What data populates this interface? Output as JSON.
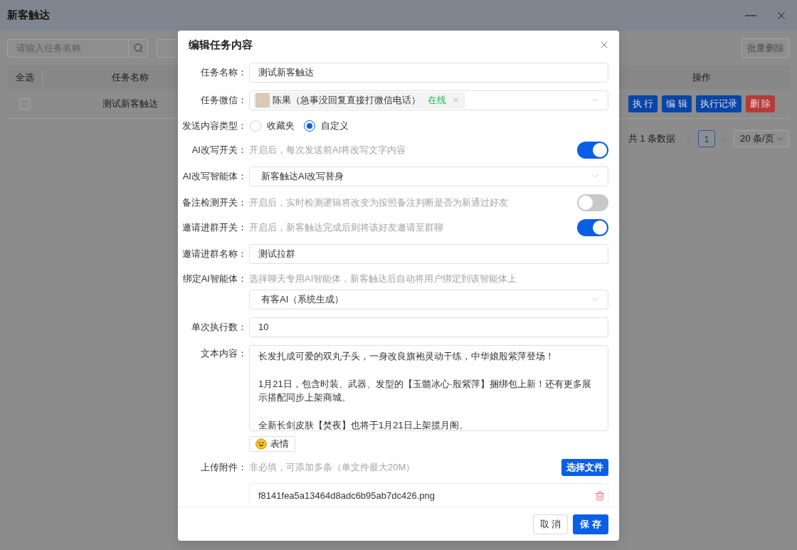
{
  "app": {
    "title": "新客触达"
  },
  "toolbar": {
    "search": {
      "placeholder": "请输入任务名称"
    },
    "batch_delete": {
      "label": "批量删除",
      "disabled": true
    }
  },
  "table": {
    "columns": [
      {
        "label": "全选",
        "kind": "select"
      },
      {
        "label": "任务名称",
        "kind": "name"
      },
      {
        "label": "操作",
        "kind": "actions"
      }
    ],
    "rows": [
      {
        "checked": false,
        "name": "测试新客触达",
        "actions": [
          {
            "label": "执 行",
            "kind": "primary"
          },
          {
            "label": "编 辑",
            "kind": "primary"
          },
          {
            "label": "执行记录",
            "kind": "primary"
          },
          {
            "label": "删 除",
            "kind": "danger"
          }
        ]
      }
    ]
  },
  "pagination": {
    "total": "共 1 条数据",
    "pages": [
      {
        "label": "1",
        "selected": true
      }
    ],
    "page_size": "20 条/页"
  },
  "dialog": {
    "title": "编辑任务内容",
    "fields": [
      {
        "kind": "input",
        "label": "任务名称：",
        "value": "测试新客触达"
      },
      {
        "kind": "tags",
        "label": "任务微信：",
        "tags": [
          {
            "name": "陈果（急事没回复直接打微信电话）",
            "status": "在线"
          }
        ]
      },
      {
        "kind": "radio",
        "label": "发送内容类型：",
        "options": [
          {
            "label": "收藏夹",
            "selected": false
          },
          {
            "label": "自定义",
            "selected": true
          }
        ]
      },
      {
        "kind": "switch",
        "label": "AI改写开关：",
        "hint": "开启后，每次发送前AI将改写文字内容",
        "on": true
      },
      {
        "kind": "select",
        "label": "AI改写智能体：",
        "value": "新客触达AI改写替身"
      },
      {
        "kind": "switch",
        "label": "备注检测开关：",
        "hint": "开启后，实时检测逻辑将改变为按照备注判断是否为新通过好友",
        "on": false
      },
      {
        "kind": "switch",
        "label": "邀请进群开关：",
        "hint": "开启后，新客触达完成后则将该好友邀请至群聊",
        "on": true
      },
      {
        "kind": "input",
        "label": "邀请进群名称：",
        "value": "测试拉群"
      },
      {
        "kind": "select",
        "label": "绑定AI智能体：",
        "hint": "选择聊天专用AI智能体，新客触达后自动将用户绑定到该智能体上",
        "value": "有客AI（系统生成）"
      },
      {
        "kind": "input",
        "label": "单次执行数：",
        "value": "10"
      },
      {
        "kind": "textarea",
        "label": "文本内容：",
        "paragraphs": [
          "长发扎成可爱的双丸子头，一身改良旗袍灵动干练，中华娘殷紫萍登场！",
          "1月21日，包含时装、武器、发型的【玉髓冰心·殷紫萍】捆绑包上新！还有更多展示搭配同步上架商城。",
          "全新长剑皮肤【焚夜】也将于1月21日上架揽月阁。"
        ],
        "emoji_button": "表情"
      },
      {
        "kind": "upload",
        "label": "上传附件：",
        "hint": "非必填，可添加多条（单文件最大20M）",
        "button": "选择文件",
        "files": [
          {
            "name": "f8141fea5a13464d8adc6b95ab7dc426.png"
          }
        ]
      }
    ],
    "buttons": [
      {
        "label": "取 消",
        "kind": "default"
      },
      {
        "label": "保 存",
        "kind": "primary"
      }
    ]
  }
}
